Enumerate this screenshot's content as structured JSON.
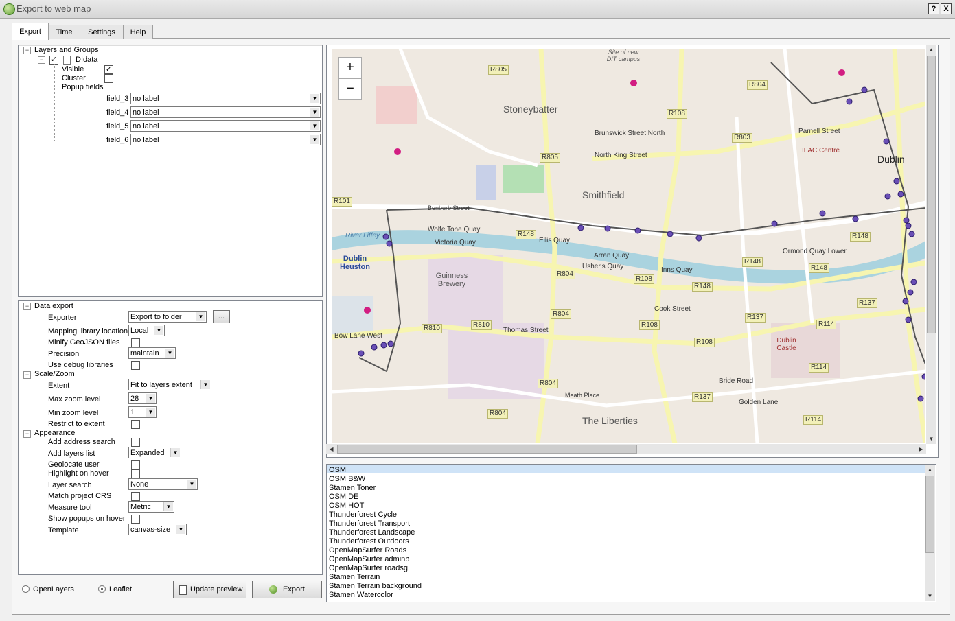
{
  "window": {
    "title": "Export to web map",
    "help_btn": "?",
    "close_btn": "X"
  },
  "tabs": [
    "Export",
    "Time",
    "Settings",
    "Help"
  ],
  "layers": {
    "root": "Layers and Groups",
    "layer_name": "DIdata",
    "visible_label": "Visible",
    "cluster_label": "Cluster",
    "popup_label": "Popup fields",
    "fields": [
      {
        "name": "field_3",
        "value": "no label"
      },
      {
        "name": "field_4",
        "value": "no label"
      },
      {
        "name": "field_5",
        "value": "no label"
      },
      {
        "name": "field_6",
        "value": "no label"
      }
    ]
  },
  "settings": {
    "data_export": "Data export",
    "exporter_label": "Exporter",
    "exporter_value": "Export to folder",
    "browse": "...",
    "maplib_label": "Mapping library location",
    "maplib_value": "Local",
    "minify_label": "Minify GeoJSON files",
    "precision_label": "Precision",
    "precision_value": "maintain",
    "debug_label": "Use debug libraries",
    "scale_zoom": "Scale/Zoom",
    "extent_label": "Extent",
    "extent_value": "Fit to layers extent",
    "maxzoom_label": "Max zoom level",
    "maxzoom_value": "28",
    "minzoom_label": "Min zoom level",
    "minzoom_value": "1",
    "restrict_label": "Restrict to extent",
    "appearance": "Appearance",
    "address_label": "Add address search",
    "layerslist_label": "Add layers list",
    "layerslist_value": "Expanded",
    "geolocate_label": "Geolocate user",
    "highlight_label": "Highlight on hover",
    "layersearch_label": "Layer search",
    "layersearch_value": "None",
    "crs_label": "Match project CRS",
    "measure_label": "Measure tool",
    "measure_value": "Metric",
    "popups_label": "Show popups on hover",
    "template_label": "Template",
    "template_value": "canvas-size"
  },
  "footer": {
    "openlayers": "OpenLayers",
    "leaflet": "Leaflet",
    "update_preview": "Update preview",
    "export": "Export"
  },
  "map_labels": {
    "zoom_in": "+",
    "zoom_out": "−",
    "places": [
      "Stoneybatter",
      "Smithfield",
      "Dublin",
      "Guinness Brewery",
      "The Liberties",
      "Dublin Heuston",
      "Dublin Castle",
      "ILAC Centre",
      "Site of new DIT campus"
    ],
    "streets": [
      "Wolfe Tone Quay",
      "Victoria Quay",
      "Ellis Quay",
      "Arran Quay",
      "Usher's Quay",
      "Inns Quay",
      "Ormond Quay Lower",
      "Thomas Street",
      "North King Street",
      "Parnell Street",
      "Brunswick Street North",
      "Benburb Street",
      "Cook Street",
      "Bow Lane West",
      "Bride Road",
      "Golden Lane",
      "Meath Place"
    ],
    "roads": [
      "R805",
      "R804",
      "R108",
      "R803",
      "R805",
      "R148",
      "R148",
      "R804",
      "R108",
      "R148",
      "R148",
      "R810",
      "R810",
      "R804",
      "R804",
      "R804",
      "R108",
      "R108",
      "R137",
      "R137",
      "R137",
      "R114",
      "R114",
      "R114",
      "R101",
      "R148"
    ],
    "river": "River Liffey"
  },
  "basemaps": [
    "OSM",
    "OSM B&W",
    "Stamen Toner",
    "OSM DE",
    "OSM HOT",
    "Thunderforest Cycle",
    "Thunderforest Transport",
    "Thunderforest Landscape",
    "Thunderforest Outdoors",
    "OpenMapSurfer Roads",
    "OpenMapSurfer adminb",
    "OpenMapSurfer roadsg",
    "Stamen Terrain",
    "Stamen Terrain background",
    "Stamen Watercolor"
  ]
}
